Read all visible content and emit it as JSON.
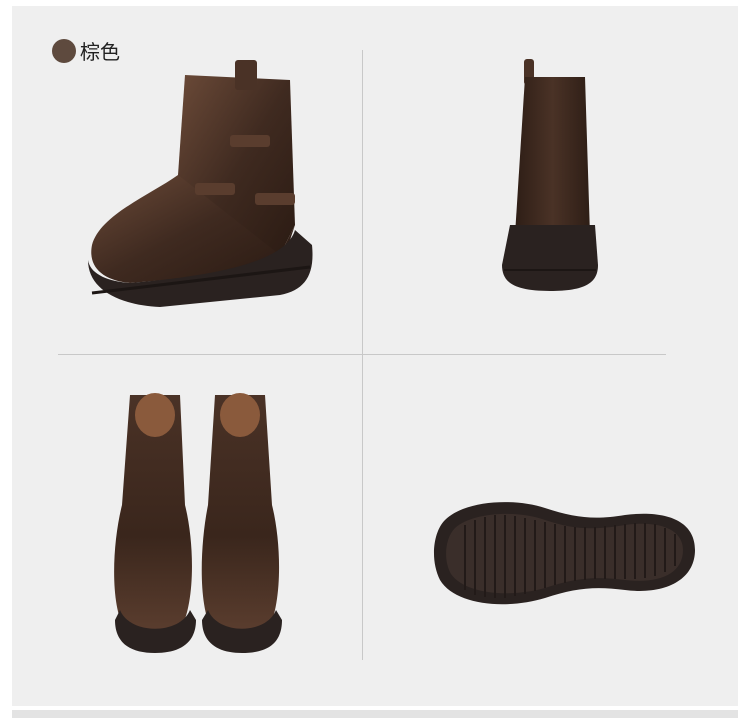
{
  "color_option": {
    "label": "棕色",
    "swatch_color": "#5e4a3e"
  },
  "photos": [
    {
      "name": "boot-side-view-photo"
    },
    {
      "name": "boot-back-view-photo"
    },
    {
      "name": "boots-front-pair-photo"
    },
    {
      "name": "boot-sole-photo"
    }
  ],
  "colors": {
    "leather": "#3f2a20",
    "leather_highlight": "#6b4a38",
    "sole": "#2a2220",
    "lining": "#8a5a3c",
    "background": "#efefef"
  }
}
